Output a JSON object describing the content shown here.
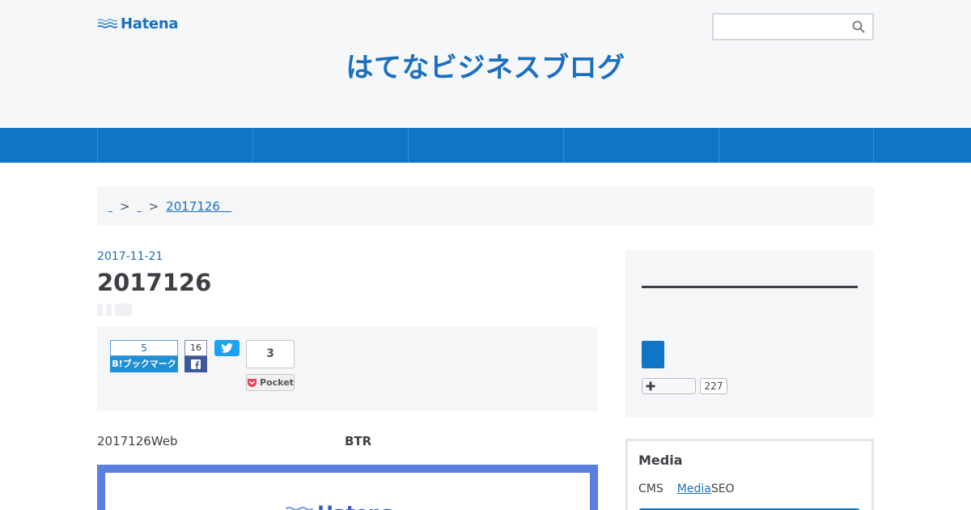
{
  "header": {
    "logo_text": "Hatena",
    "blog_title": "はてなビジネスブログ",
    "search": {
      "value": "",
      "placeholder": ""
    }
  },
  "nav": {
    "items": [
      "",
      "",
      "",
      "",
      ""
    ]
  },
  "breadcrumb": {
    "sep": ">",
    "current": "2017126"
  },
  "article": {
    "date": "2017-11-21",
    "title": "2017126",
    "share": {
      "hatena_count": "5",
      "hatena_label": "B!ブックマーク",
      "facebook_count": "16",
      "pocket_count": "3",
      "pocket_label": "Pocket"
    },
    "intro_text": "2017126Web",
    "intro_bold": "BTR",
    "image_logo_text": "Hatena"
  },
  "sidebar": {
    "follow_count": "227",
    "media": {
      "title": "Media",
      "prefix": "CMS",
      "link": "Media",
      "suffix": "SEO"
    }
  },
  "colors": {
    "brand_blue": "#0f76c7",
    "link_blue": "#1a6fbf",
    "header_bg": "#f6f7f9",
    "panel_bg": "#f4f6f8"
  },
  "icons": {
    "logo": "hatena-wave-logo",
    "search": "magnifier-icon",
    "facebook": "facebook-f-icon",
    "twitter": "twitter-bird-icon",
    "pocket": "pocket-icon",
    "follow": "plus-icon"
  }
}
